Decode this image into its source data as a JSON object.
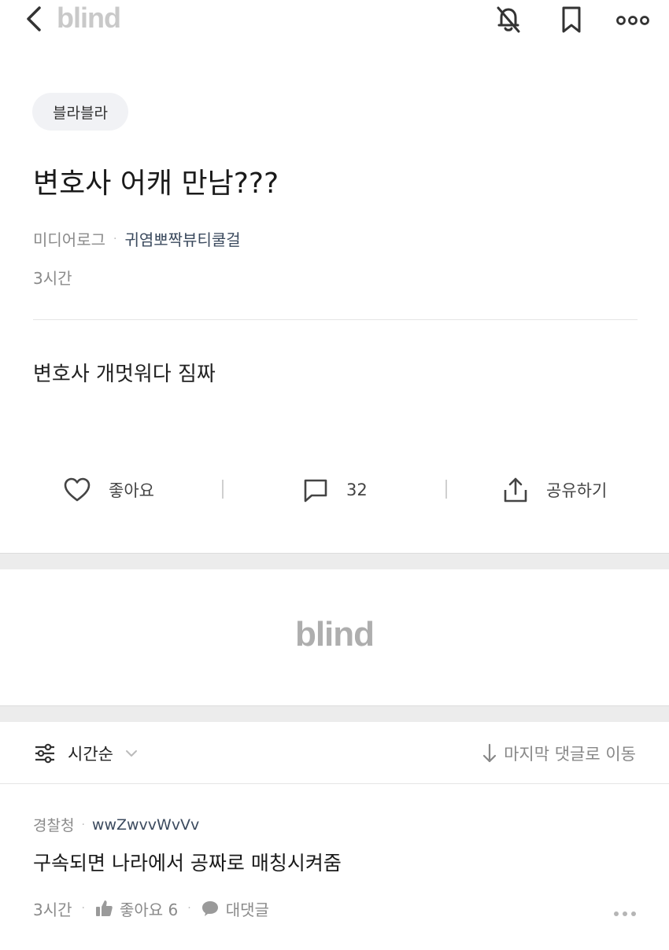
{
  "header": {
    "logo": "blind"
  },
  "post": {
    "category": "블라블라",
    "title": "변호사 어캐 만남???",
    "company": "미디어로그",
    "separator": "·",
    "author": "귀염뽀짝뷰티쿨걸",
    "time": "3시간",
    "body": "변호사 개멋워다 짐짜"
  },
  "actions": {
    "like_label": "좋아요",
    "comment_count": "32",
    "share_label": "공유하기"
  },
  "ad": {
    "logo": "blind"
  },
  "comments_bar": {
    "sort_label": "시간순",
    "jump_label": "마지막 댓글로 이동"
  },
  "comments": [
    {
      "company": "경찰청",
      "separator": "·",
      "author": "wwZwvvWvVv",
      "text": "구속되면 나라에서 공짜로 매칭시켜줌",
      "time": "3시간",
      "like_label": "좋아요 6",
      "reply_label": "대댓글"
    }
  ],
  "colors": {
    "accent_text": "#3b4a5e",
    "muted": "#8a8a8a",
    "band": "#ececec"
  }
}
